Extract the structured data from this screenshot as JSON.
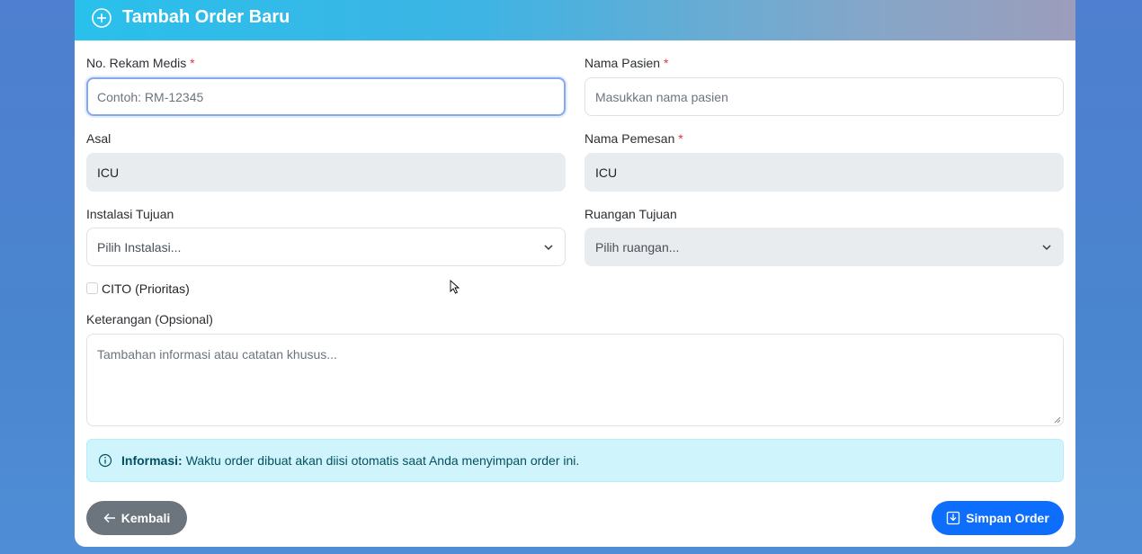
{
  "header": {
    "title": "Tambah Order Baru",
    "icon": "plus-circle-icon"
  },
  "form": {
    "rekam_medis": {
      "label": "No. Rekam Medis",
      "required_mark": "*",
      "placeholder": "Contoh: RM-12345"
    },
    "nama_pasien": {
      "label": "Nama Pasien",
      "required_mark": "*",
      "placeholder": "Masukkan nama pasien"
    },
    "asal": {
      "label": "Asal",
      "value": "ICU"
    },
    "nama_pemesan": {
      "label": "Nama Pemesan",
      "required_mark": "*",
      "value": "ICU"
    },
    "instalasi_tujuan": {
      "label": "Instalasi Tujuan",
      "selected": "Pilih Instalasi..."
    },
    "ruangan_tujuan": {
      "label": "Ruangan Tujuan",
      "selected": "Pilih ruangan..."
    },
    "cito": {
      "label": "CITO (Prioritas)",
      "checked": false
    },
    "keterangan": {
      "label": "Keterangan (Opsional)",
      "placeholder": "Tambahan informasi atau catatan khusus..."
    }
  },
  "info": {
    "title": "Informasi:",
    "text": "Waktu order dibuat akan diisi otomatis saat Anda menyimpan order ini."
  },
  "buttons": {
    "back": "Kembali",
    "save": "Simpan Order"
  },
  "colors": {
    "primary": "#0d6efd",
    "secondary": "#6c757d",
    "info_bg": "#cff4fc",
    "required": "#dc3545"
  }
}
